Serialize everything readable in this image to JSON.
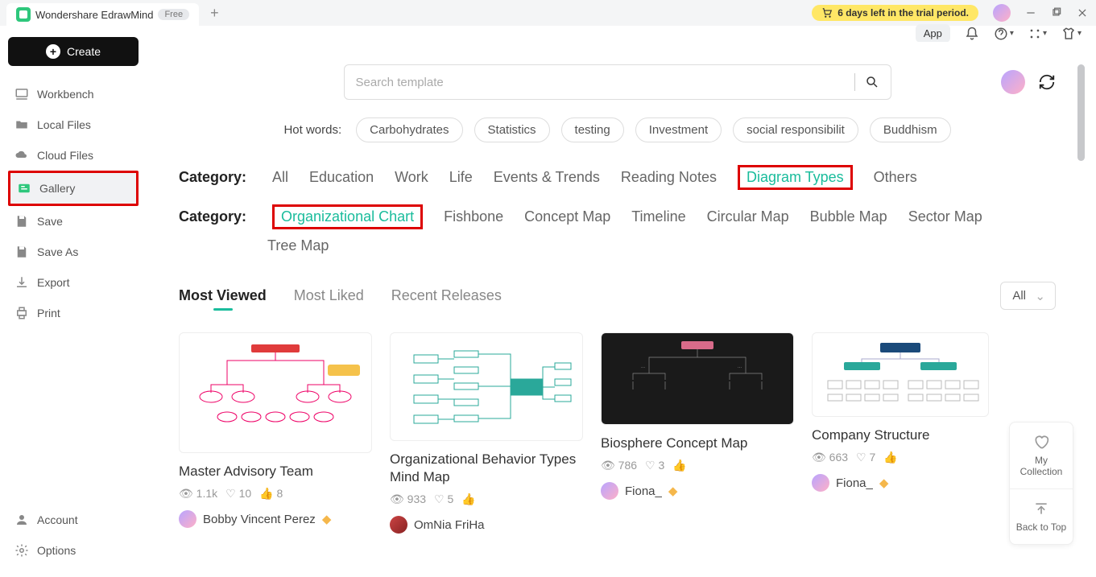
{
  "titlebar": {
    "app_name": "Wondershare EdrawMind",
    "free_label": "Free",
    "trial_text": "6 days left in the trial period."
  },
  "sidebar": {
    "create_label": "Create",
    "items": [
      {
        "label": "Workbench"
      },
      {
        "label": "Local Files"
      },
      {
        "label": "Cloud Files"
      },
      {
        "label": "Gallery"
      },
      {
        "label": "Save"
      },
      {
        "label": "Save As"
      },
      {
        "label": "Export"
      },
      {
        "label": "Print"
      }
    ],
    "footer": [
      {
        "label": "Account"
      },
      {
        "label": "Options"
      }
    ]
  },
  "toolbar_app_label": "App",
  "search": {
    "placeholder": "Search template"
  },
  "hot": {
    "label": "Hot words:",
    "words": [
      "Carbohydrates",
      "Statistics",
      "testing",
      "Investment",
      "social responsibilit",
      "Buddhism"
    ]
  },
  "category1": {
    "label": "Category:",
    "items": [
      "All",
      "Education",
      "Work",
      "Life",
      "Events & Trends",
      "Reading Notes",
      "Diagram Types",
      "Others"
    ],
    "active": "Diagram Types"
  },
  "category2": {
    "label": "Category:",
    "items": [
      "Organizational Chart",
      "Fishbone",
      "Concept Map",
      "Timeline",
      "Circular Map",
      "Bubble Map",
      "Sector Map"
    ],
    "extra": [
      "Tree Map"
    ],
    "active": "Organizational Chart"
  },
  "sort": {
    "items": [
      "Most Viewed",
      "Most Liked",
      "Recent Releases"
    ],
    "active": "Most Viewed",
    "filter": "All"
  },
  "cards": [
    {
      "title": "Master Advisory Team",
      "views": "1.1k",
      "likes": "10",
      "thumbs": "8",
      "author": "Bobby Vincent Perez"
    },
    {
      "title": "Organizational Behavior Types Mind Map",
      "views": "933",
      "likes": "5",
      "thumbs": "",
      "author": "OmNia FriHa"
    },
    {
      "title": "Biosphere Concept Map",
      "views": "786",
      "likes": "3",
      "thumbs": "",
      "author": "Fiona_"
    },
    {
      "title": "Company Structure",
      "views": "663",
      "likes": "7",
      "thumbs": "",
      "author": "Fiona_"
    }
  ],
  "float": {
    "collection": "My Collection",
    "backtop": "Back to Top"
  }
}
